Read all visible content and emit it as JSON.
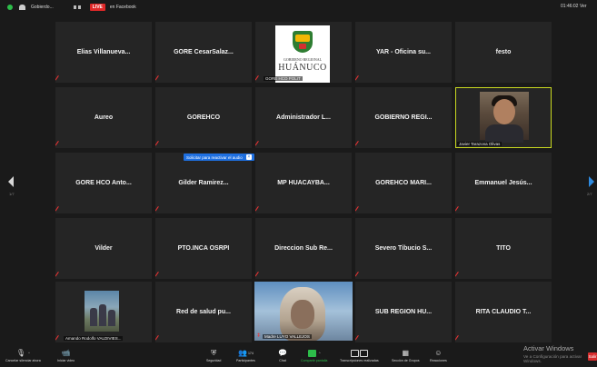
{
  "topbar": {
    "title": "Gobierdo...",
    "live": "LIVE",
    "live_target": "en Facebook",
    "clock": "01:46:02",
    "view": "Ver"
  },
  "pages": {
    "left": "1/7",
    "right": "2/7"
  },
  "tiles": [
    {
      "name": "Elias Villanueva..."
    },
    {
      "name": "GORE CesarSalaz..."
    },
    {
      "name": "",
      "tag": "GORE HCO POLIT"
    },
    {
      "name": "YAR - Oficina su..."
    },
    {
      "name": "festo"
    },
    {
      "name": "Aureo"
    },
    {
      "name": "GOREHCO"
    },
    {
      "name": "Administrador L..."
    },
    {
      "name": "GOBIERNO REGI..."
    },
    {
      "name": "",
      "tag": "Javier Tarazona Olivas"
    },
    {
      "name": "GORE HCO Anto..."
    },
    {
      "name": "Gilder Ramirez..."
    },
    {
      "name": "MP HUACAYBA..."
    },
    {
      "name": "GOREHCO MARI..."
    },
    {
      "name": "Emmanuel Jesús..."
    },
    {
      "name": "Vilder"
    },
    {
      "name": "PTO.INCA OSRPI"
    },
    {
      "name": "Direccion Sub Re..."
    },
    {
      "name": "Severo Tibucio S..."
    },
    {
      "name": "TITO"
    },
    {
      "name": "",
      "tag": "Amando Rodolfo VALDIVIES..."
    },
    {
      "name": "Red de salud pu..."
    },
    {
      "name": "",
      "tag": "Madre LUYO VALLEJOS"
    },
    {
      "name": "SUB REGION HU..."
    },
    {
      "name": "RITA CLAUDIO T..."
    }
  ],
  "logo": {
    "line1": "GOBIERNO REGIONAL",
    "line2": "HUÁNUCO"
  },
  "tooltip": {
    "text": "Solicitar para reactivar el audio",
    "close": "×"
  },
  "toolbar": {
    "mute": "Cancelar silenciar ahora",
    "video": "Iniciar video",
    "security": "Seguridad",
    "participants": "Participantes",
    "participants_count": "174",
    "chat": "Chat",
    "share": "Compartir pantalla",
    "poll": "Transcripciones realizadas",
    "breakout": "Sección de Grupos",
    "reactions": "Reacciones"
  },
  "windows": {
    "activate": "Activar Windows",
    "hint": "Ve a Configuración para activar Windows.",
    "leave": "Salir"
  },
  "colors": {
    "live": "#e02828",
    "share": "#2dbd4a",
    "active_border": "#c8d820",
    "leave": "#d62e2e",
    "tooltip": "#1e6fe0"
  }
}
